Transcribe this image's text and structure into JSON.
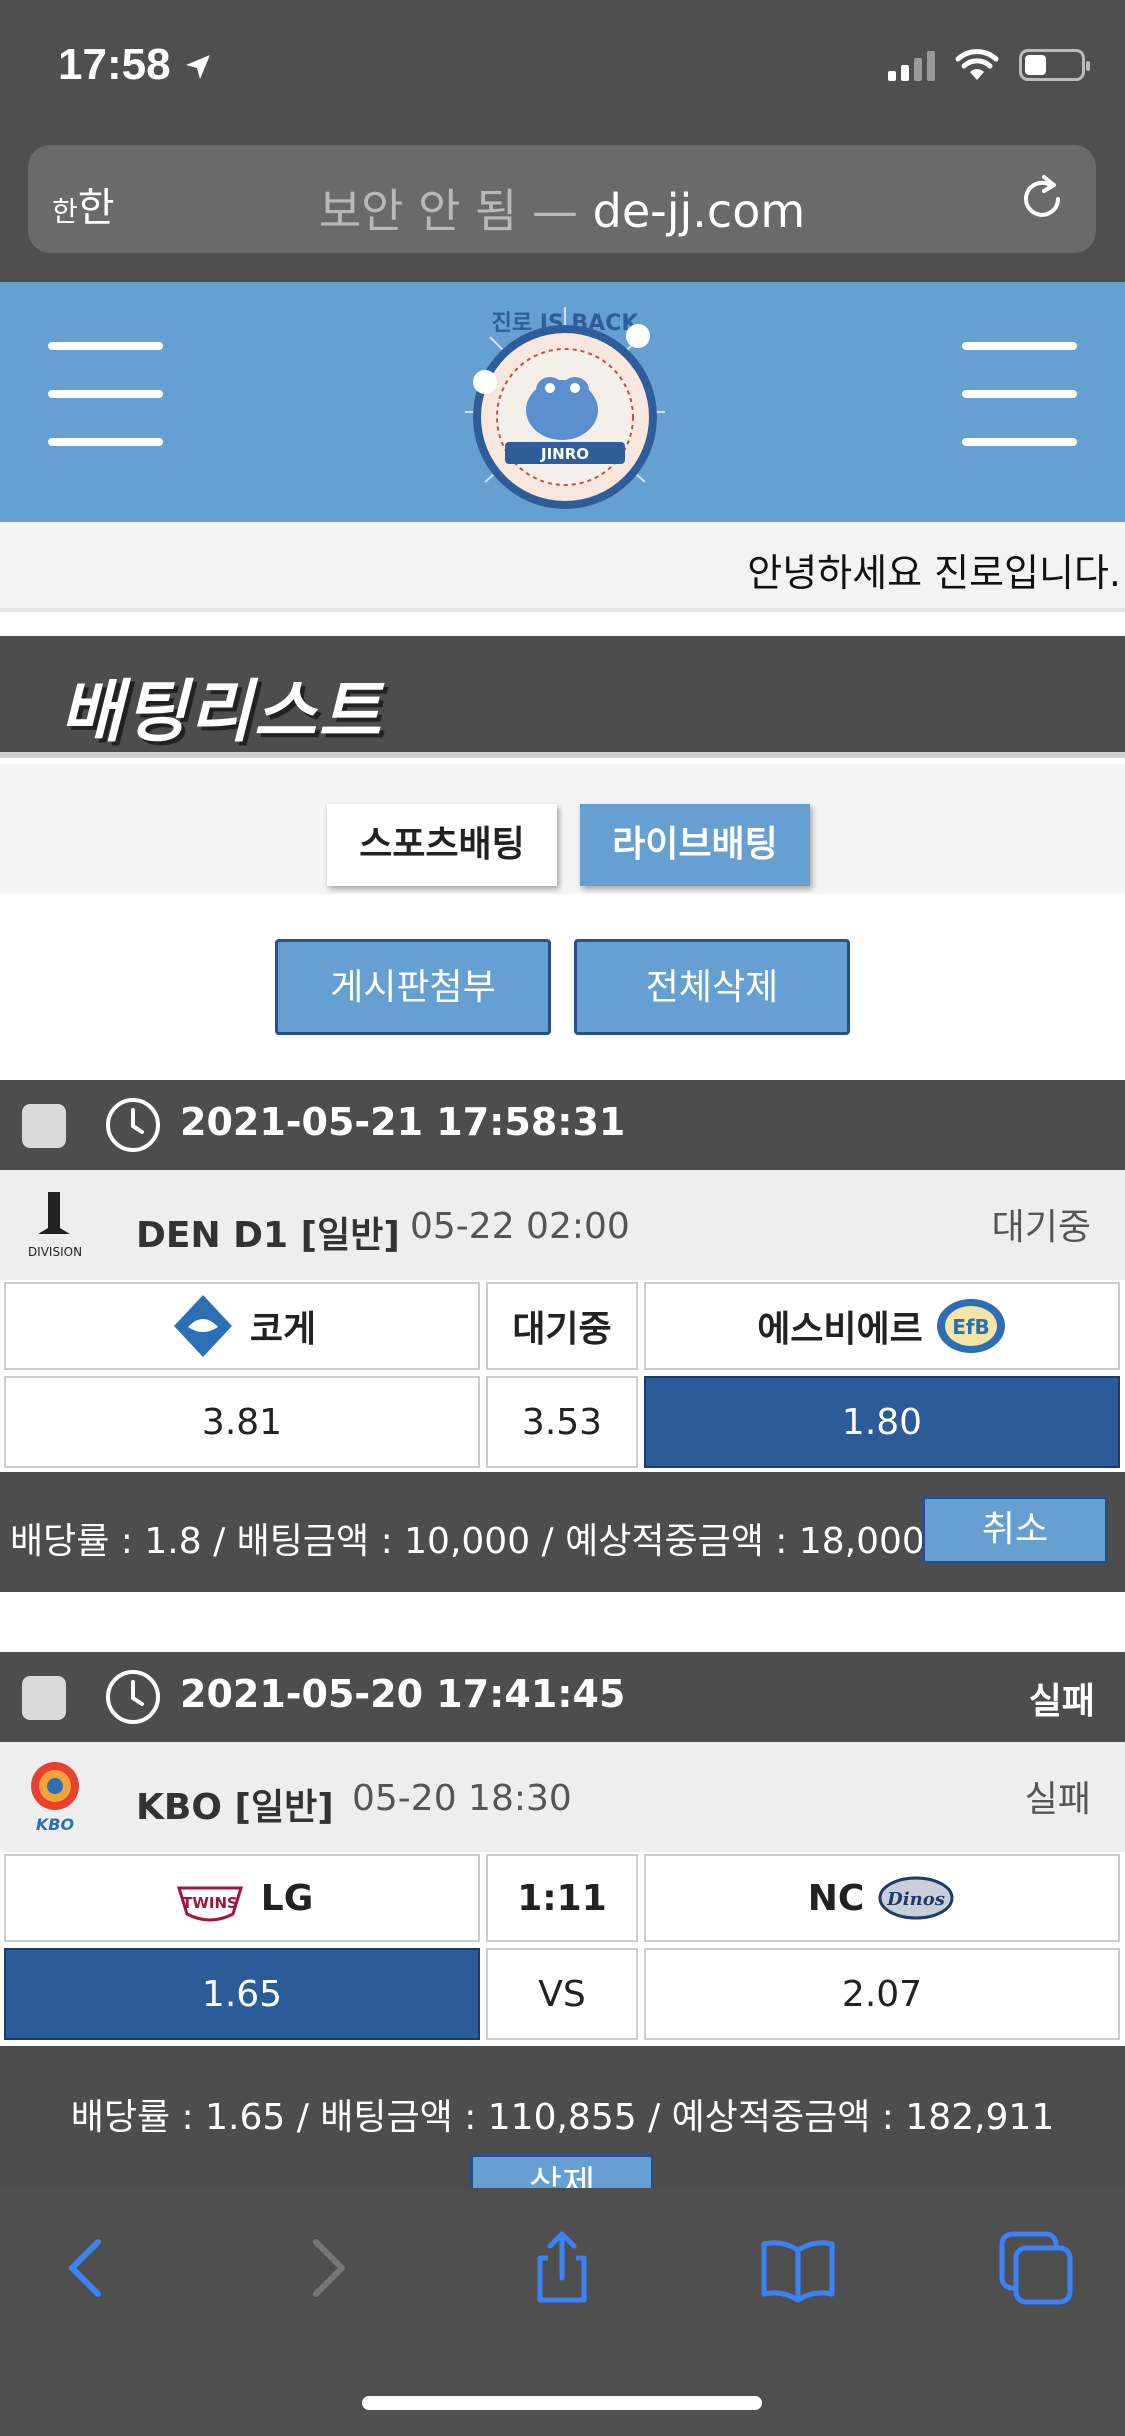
{
  "status_bar": {
    "time": "17:58"
  },
  "browser": {
    "aa_label_small": "한",
    "aa_label": "한",
    "security_text": "보안 안 됨 —",
    "domain": "de-jj.com"
  },
  "header": {
    "logo_text_top": "진로 IS BACK",
    "logo_text_band": "JINRO"
  },
  "greeting": "안녕하세요 진로입니다.",
  "section_title": "배팅리스트",
  "tabs": {
    "sports": "스포츠배팅",
    "live": "라이브배팅"
  },
  "actions": {
    "attach": "게시판첨부",
    "delete_all": "전체삭제"
  },
  "bets": [
    {
      "datetime": "2021-05-21 17:58:31",
      "status": "",
      "league": "DEN D1",
      "type": "[일반]",
      "game_time": "05-22 02:00",
      "game_status": "대기중",
      "league_logo_text": "DIVISION",
      "home": "코게",
      "middle": "대기중",
      "away": "에스비에르",
      "away_logo_text": "EfB",
      "home_odds": "3.81",
      "draw_odds": "3.53",
      "away_odds": "1.80",
      "summary": "배당률 : 1.8 / 배팅금액 : 10,000 / 예상적중금액 : 18,000",
      "button": "취소"
    },
    {
      "datetime": "2021-05-20 17:41:45",
      "status": "실패",
      "league": "KBO",
      "type": "[일반]",
      "game_time": "05-20 18:30",
      "game_status": "실패",
      "league_logo_text": "KBO",
      "home": "LG",
      "home_logo_text": "TWINS",
      "middle": "1:11",
      "away": "NC",
      "away_logo_text": "Dinos",
      "home_odds": "1.65",
      "draw_odds": "VS",
      "away_odds": "2.07",
      "summary": "배당률 : 1.65 / 배팅금액 : 110,855 / 예상적중금액 : 182,911",
      "button": "삭제"
    }
  ],
  "colors": {
    "accent": "#66a0d2",
    "selected": "#2b5b99",
    "dark": "#4d4d4d"
  },
  "toolbar_icons": [
    "back-icon",
    "forward-icon",
    "share-icon",
    "bookmarks-icon",
    "tabs-icon"
  ]
}
